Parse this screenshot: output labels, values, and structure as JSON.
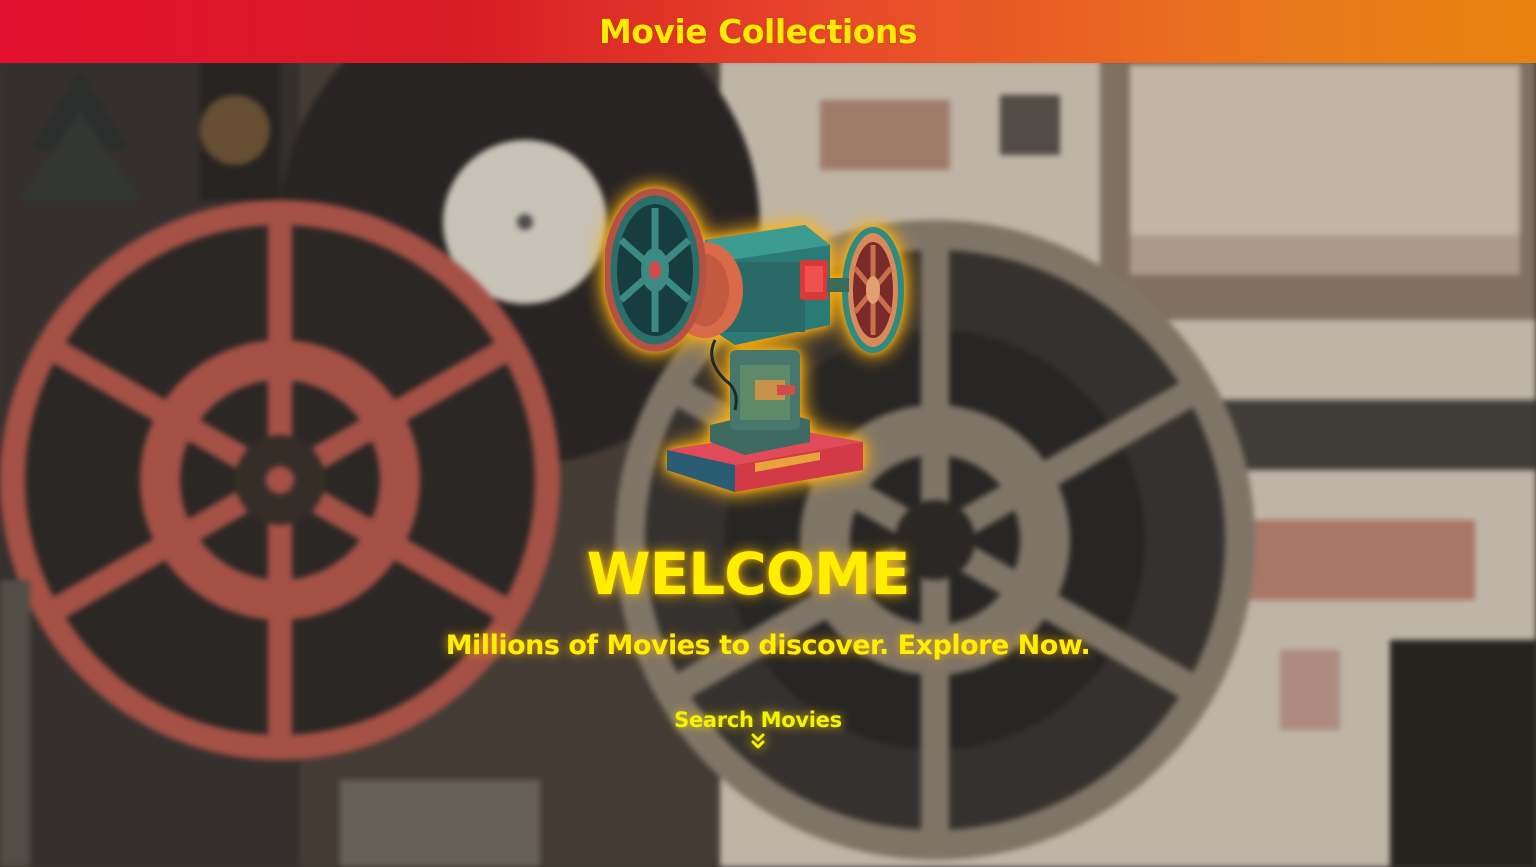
{
  "header": {
    "title": "Movie Collections"
  },
  "hero": {
    "image_icon": "film-projector-icon",
    "heading": "WELCOME",
    "tagline": "Millions of Movies to discover. Explore Now.",
    "search_link_label": "Search Movies",
    "search_link_icon": "double-chevron-down-icon"
  },
  "colors": {
    "header_gradient_start": "#e2102e",
    "header_gradient_end": "#e9820e",
    "accent_text": "#ffee00",
    "glow": "#ffb400"
  }
}
